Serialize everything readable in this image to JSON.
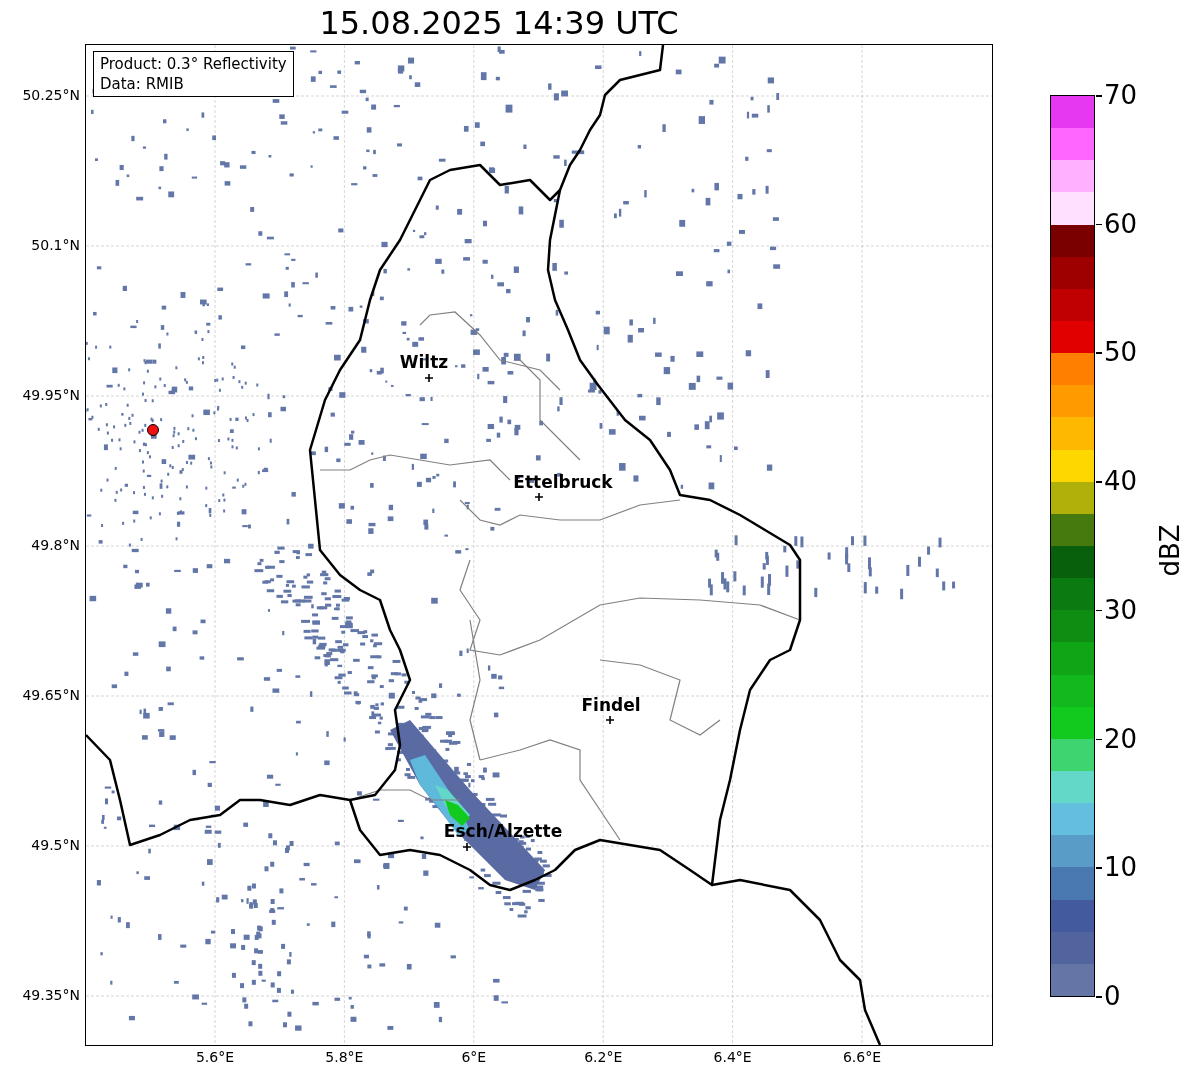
{
  "title": "15.08.2025 14:39 UTC",
  "info_box": [
    "Product: 0.3° Reflectivity",
    "Data: RMIB"
  ],
  "y_ticks": [
    "50.25°N",
    "50.1°N",
    "49.95°N",
    "49.8°N",
    "49.65°N",
    "49.5°N",
    "49.35°N"
  ],
  "x_ticks": [
    "5.6°E",
    "5.8°E",
    "6°E",
    "6.2°E",
    "6.4°E",
    "6.6°E"
  ],
  "places": [
    {
      "name": "Wiltz"
    },
    {
      "name": "Ettelbruck"
    },
    {
      "name": "Findel"
    },
    {
      "name": "Esch/Alzette"
    }
  ],
  "colorbar": {
    "label": "dBZ",
    "ticks": [
      "70",
      "60",
      "50",
      "40",
      "30",
      "20",
      "10",
      "0"
    ],
    "segments": [
      {
        "color": "#e638f0"
      },
      {
        "color": "#ff66ff"
      },
      {
        "color": "#ffb0ff"
      },
      {
        "color": "#ffe0ff"
      },
      {
        "color": "#7a0000"
      },
      {
        "color": "#9e0000"
      },
      {
        "color": "#c00000"
      },
      {
        "color": "#e10000"
      },
      {
        "color": "#ff7f00"
      },
      {
        "color": "#ff9a00"
      },
      {
        "color": "#ffb800"
      },
      {
        "color": "#ffd700"
      },
      {
        "color": "#b0b00a"
      },
      {
        "color": "#467a0f"
      },
      {
        "color": "#085f0c"
      },
      {
        "color": "#0b7a10"
      },
      {
        "color": "#0e8d12"
      },
      {
        "color": "#10a516"
      },
      {
        "color": "#12b81c"
      },
      {
        "color": "#12c91e"
      },
      {
        "color": "#3ed570"
      },
      {
        "color": "#64d8c8"
      },
      {
        "color": "#64bedd"
      },
      {
        "color": "#5a9cc8"
      },
      {
        "color": "#4a78b1"
      },
      {
        "color": "#435b9e"
      },
      {
        "color": "#52649e"
      },
      {
        "color": "#6575a6"
      }
    ]
  }
}
